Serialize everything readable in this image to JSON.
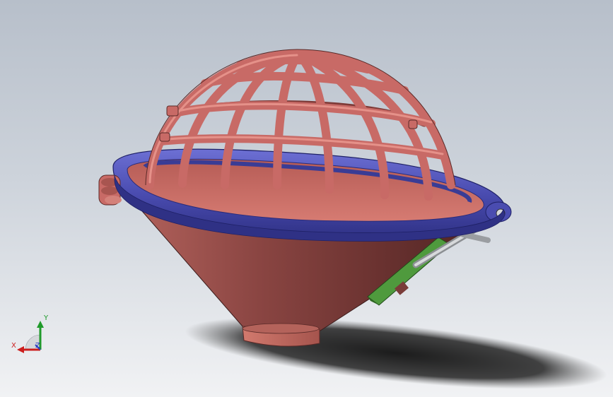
{
  "view": {
    "background_top": "#b7bfca",
    "background_bottom": "#f1f2f4"
  },
  "model": {
    "cage_color": "#c86a66",
    "rim_color": "#4b4dac",
    "funnel_color": "#7a3c39",
    "bracket_color": "#4f9a3d",
    "shadow_color": "#1a1a1a"
  },
  "triad": {
    "x_label": "X",
    "y_label": "Y",
    "z_label": "Z",
    "x_color": "#cc1e1e",
    "y_color": "#1f9a2a",
    "z_color": "#2b3fc2"
  }
}
